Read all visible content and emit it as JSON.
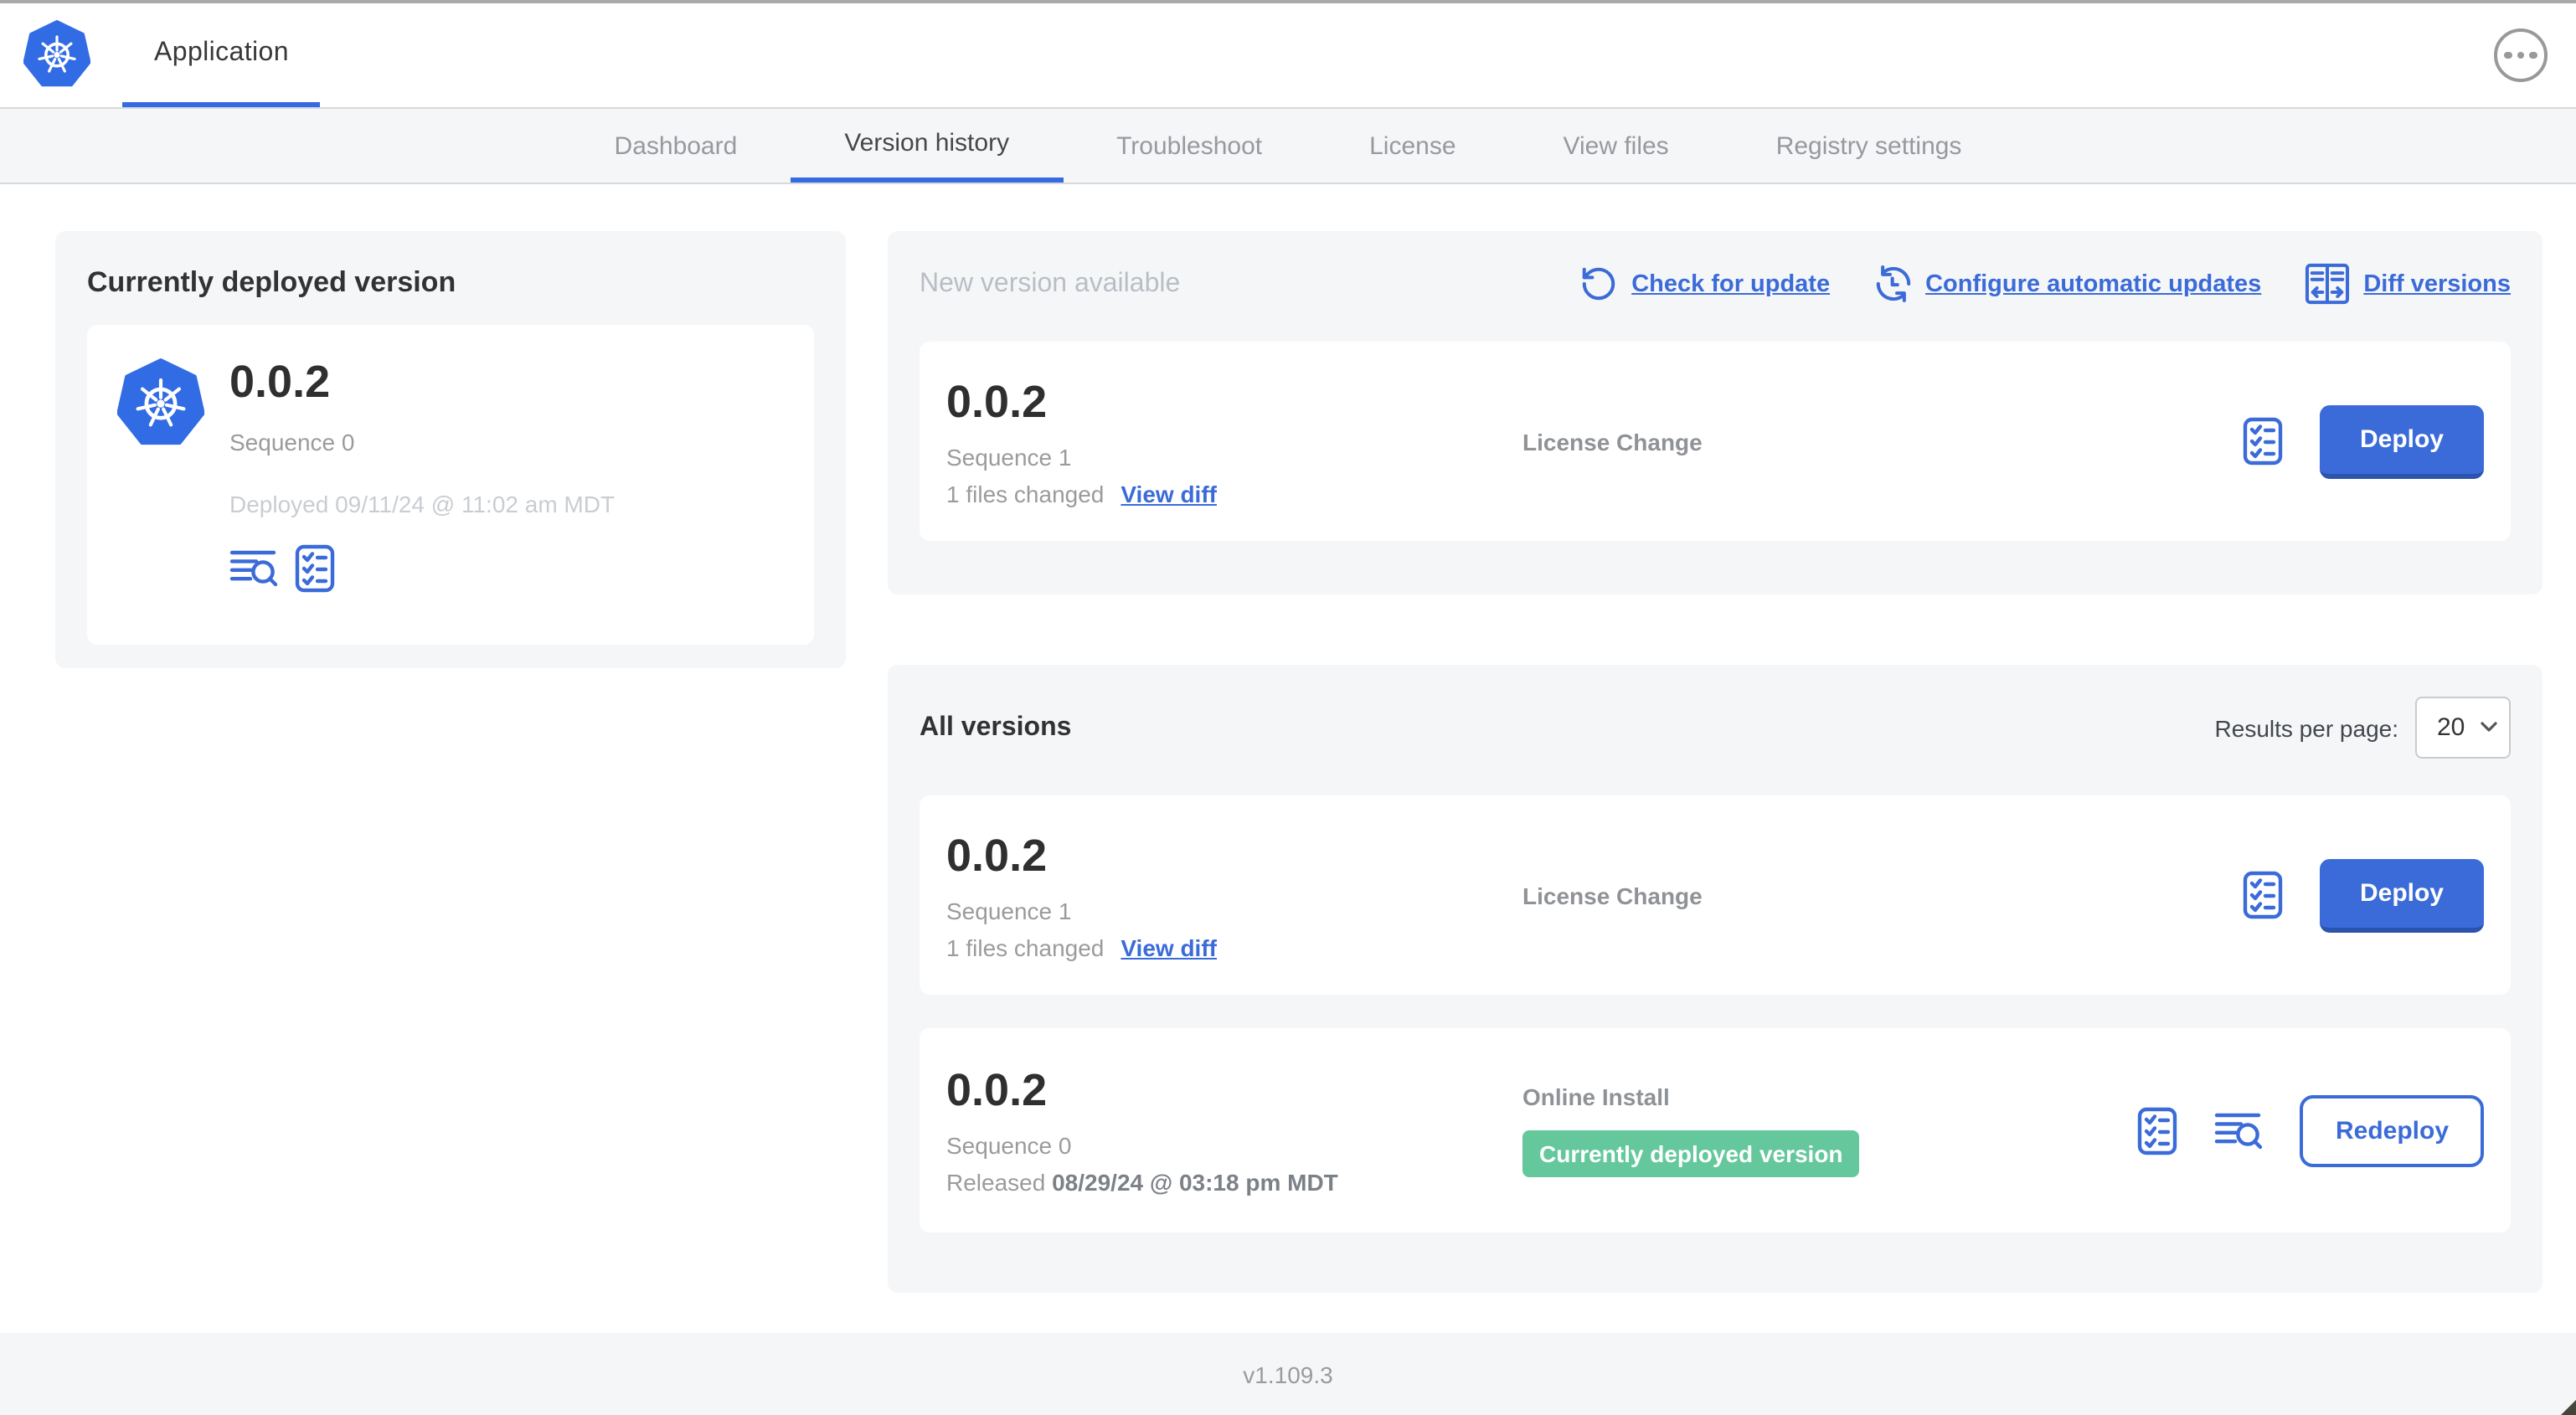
{
  "colors": {
    "primary_blue": "#3b6bd8",
    "kubernetes_blue": "#326ce5",
    "badge_green": "#65c89c",
    "panel_gray": "#f5f6f8"
  },
  "icons": {
    "logo": "kubernetes-logo-icon",
    "menu": "ellipsis-menu-icon",
    "check_update": "refresh-ccw-icon",
    "auto_update": "auto-update-clock-icon",
    "diff": "diff-columns-icon",
    "checklist": "preflight-checks-icon",
    "logs": "view-logs-icon",
    "chevron": "chevron-down-icon"
  },
  "header": {
    "app_name": "Application"
  },
  "nav": {
    "tabs": [
      {
        "label": "Dashboard",
        "active": false
      },
      {
        "label": "Version history",
        "active": true
      },
      {
        "label": "Troubleshoot",
        "active": false
      },
      {
        "label": "License",
        "active": false
      },
      {
        "label": "View files",
        "active": false
      },
      {
        "label": "Registry settings",
        "active": false
      }
    ]
  },
  "currently_deployed": {
    "title": "Currently deployed version",
    "version": "0.0.2",
    "sequence": "Sequence 0",
    "deployed_at": "Deployed 09/11/24 @ 11:02 am MDT"
  },
  "new_version": {
    "title": "New version available",
    "check_for_update": "Check for update",
    "configure_automatic_updates": "Configure automatic updates",
    "diff_versions": "Diff versions",
    "card": {
      "version": "0.0.2",
      "sequence": "Sequence 1",
      "files_changed": "1 files changed",
      "view_diff": "View diff",
      "source": "License Change",
      "deploy": "Deploy"
    }
  },
  "all_versions": {
    "title": "All versions",
    "results_per_page_label": "Results per page:",
    "results_per_page_value": "20",
    "rows": [
      {
        "version": "0.0.2",
        "sequence": "Sequence 1",
        "files_changed": "1 files changed",
        "view_diff": "View diff",
        "source": "License Change",
        "action": "Deploy"
      },
      {
        "version": "0.0.2",
        "sequence": "Sequence 0",
        "released_label": "Released",
        "released_at": "08/29/24 @ 03:18 pm MDT",
        "source": "Online Install",
        "status_badge": "Currently deployed version",
        "action": "Redeploy"
      }
    ]
  },
  "footer": {
    "app_version": "v1.109.3"
  }
}
